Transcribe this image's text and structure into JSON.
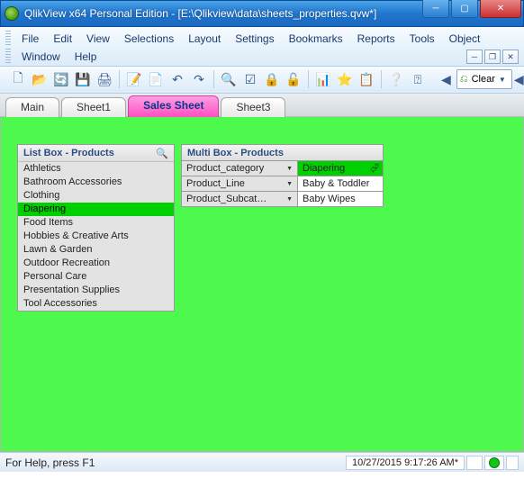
{
  "window": {
    "title": "QlikView x64 Personal Edition - [E:\\Qlikview\\data\\sheets_properties.qvw*]"
  },
  "menu": {
    "row1": [
      "File",
      "Edit",
      "View",
      "Selections",
      "Layout",
      "Settings",
      "Bookmarks",
      "Reports",
      "Tools",
      "Object"
    ],
    "row2": [
      "Window",
      "Help"
    ]
  },
  "toolbar": {
    "clear_label": "Clear"
  },
  "tabs": [
    {
      "label": "Main",
      "active": false
    },
    {
      "label": "Sheet1",
      "active": false
    },
    {
      "label": "Sales Sheet",
      "active": true
    },
    {
      "label": "Sheet3",
      "active": false
    }
  ],
  "listbox": {
    "title": "List Box - Products",
    "items": [
      {
        "label": "Athletics",
        "selected": false
      },
      {
        "label": "Bathroom Accessories",
        "selected": false
      },
      {
        "label": "Clothing",
        "selected": false
      },
      {
        "label": "Diapering",
        "selected": true
      },
      {
        "label": "Food Items",
        "selected": false
      },
      {
        "label": "Hobbies & Creative Arts",
        "selected": false
      },
      {
        "label": "Lawn & Garden",
        "selected": false
      },
      {
        "label": "Outdoor Recreation",
        "selected": false
      },
      {
        "label": "Personal Care",
        "selected": false
      },
      {
        "label": "Presentation Supplies",
        "selected": false
      },
      {
        "label": "Tool Accessories",
        "selected": false
      }
    ]
  },
  "multibox": {
    "title": "Multi Box - Products",
    "rows": [
      {
        "field": "Product_category",
        "value": "Diapering",
        "selected": true
      },
      {
        "field": "Product_Line",
        "value": "Baby & Toddler",
        "selected": false
      },
      {
        "field": "Product_Subcat…",
        "value": "Baby Wipes",
        "selected": false
      }
    ]
  },
  "status": {
    "help": "For Help, press F1",
    "datetime": "10/27/2015 9:17:26 AM*"
  }
}
